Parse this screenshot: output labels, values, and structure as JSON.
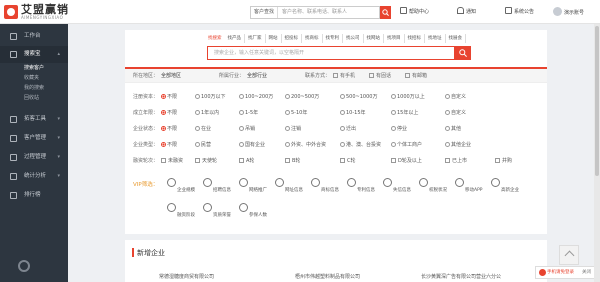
{
  "brand": {
    "name": "艾盟赢销",
    "sub": "AIMENGYINGXIAO"
  },
  "topbar": {
    "search_type": "客户查找",
    "search_placeholder": "客户名称、联系电话、联系人",
    "help": "帮助中心",
    "notify": "通知",
    "announce": "系统公告",
    "user": "演示账号"
  },
  "sidebar": {
    "items": [
      {
        "label": "工作台"
      },
      {
        "label": "搜索宝"
      },
      {
        "label": "拓客工具"
      },
      {
        "label": "客户管理"
      },
      {
        "label": "过程管理"
      },
      {
        "label": "统计分析"
      },
      {
        "label": "排行榜"
      }
    ],
    "sub": [
      "搜索客户",
      "收藏夹",
      "我的搜索",
      "回收站"
    ]
  },
  "main": {
    "tabs": [
      "找搜索",
      "找产品",
      "找厂家",
      "网站",
      "招投标",
      "找商标",
      "找专利",
      "找公司",
      "找网站",
      "找项目",
      "找招标",
      "找地址",
      "找展会"
    ],
    "search_placeholder": "搜索企业，输入任意关键词，以空格隔开",
    "location": {
      "region_label": "所在地区：",
      "region_value": "全部地区",
      "industry_label": "所属行业：",
      "industry_value": "全部行业",
      "contact_label": "联系方式：",
      "contact_opts": [
        "有手机",
        "有固话",
        "有邮箱"
      ]
    },
    "filters": [
      {
        "label": "注册资本：",
        "opts": [
          "不限",
          "100万以下",
          "100~200万",
          "200~500万",
          "500~1000万",
          "1000万以上",
          "自定义"
        ]
      },
      {
        "label": "成立年限：",
        "opts": [
          "不限",
          "1年以内",
          "1-5年",
          "5-10年",
          "10-15年",
          "15年以上",
          "自定义"
        ]
      },
      {
        "label": "企业状态：",
        "opts": [
          "不限",
          "在业",
          "吊销",
          "注销",
          "迁出",
          "停业",
          "其他"
        ]
      },
      {
        "label": "企业类型：",
        "opts": [
          "不限",
          "民营",
          "国有企业",
          "外资、中外合资",
          "港、澳、台投资",
          "个体工商户",
          "其他企业"
        ]
      },
      {
        "label": "融资轮次：",
        "opts": [
          "未融资",
          "天使轮",
          "A轮",
          "B轮",
          "C轮",
          "D轮及以上",
          "已上市",
          "并购"
        ]
      }
    ],
    "vip_label": "VIP筛选：",
    "vip_row1": [
      "企业规模",
      "招聘信息",
      "网络推广",
      "网址信息",
      "商标信息",
      "专利信息",
      "失信信息",
      "权税状况",
      "移动APP",
      "高新企业"
    ],
    "vip_row2": [
      "融资阶段",
      "资质荣誉",
      "参保人数"
    ]
  },
  "new_section": {
    "title": "新增企业",
    "companies": [
      "常德湿糖度商贸有限公司",
      "梧州市伟越塑料制品有限公司",
      "长沙黄翼深广告有限公司营业六分公"
    ]
  },
  "float": {
    "consult": "手机请免登录",
    "close": "关闭"
  }
}
